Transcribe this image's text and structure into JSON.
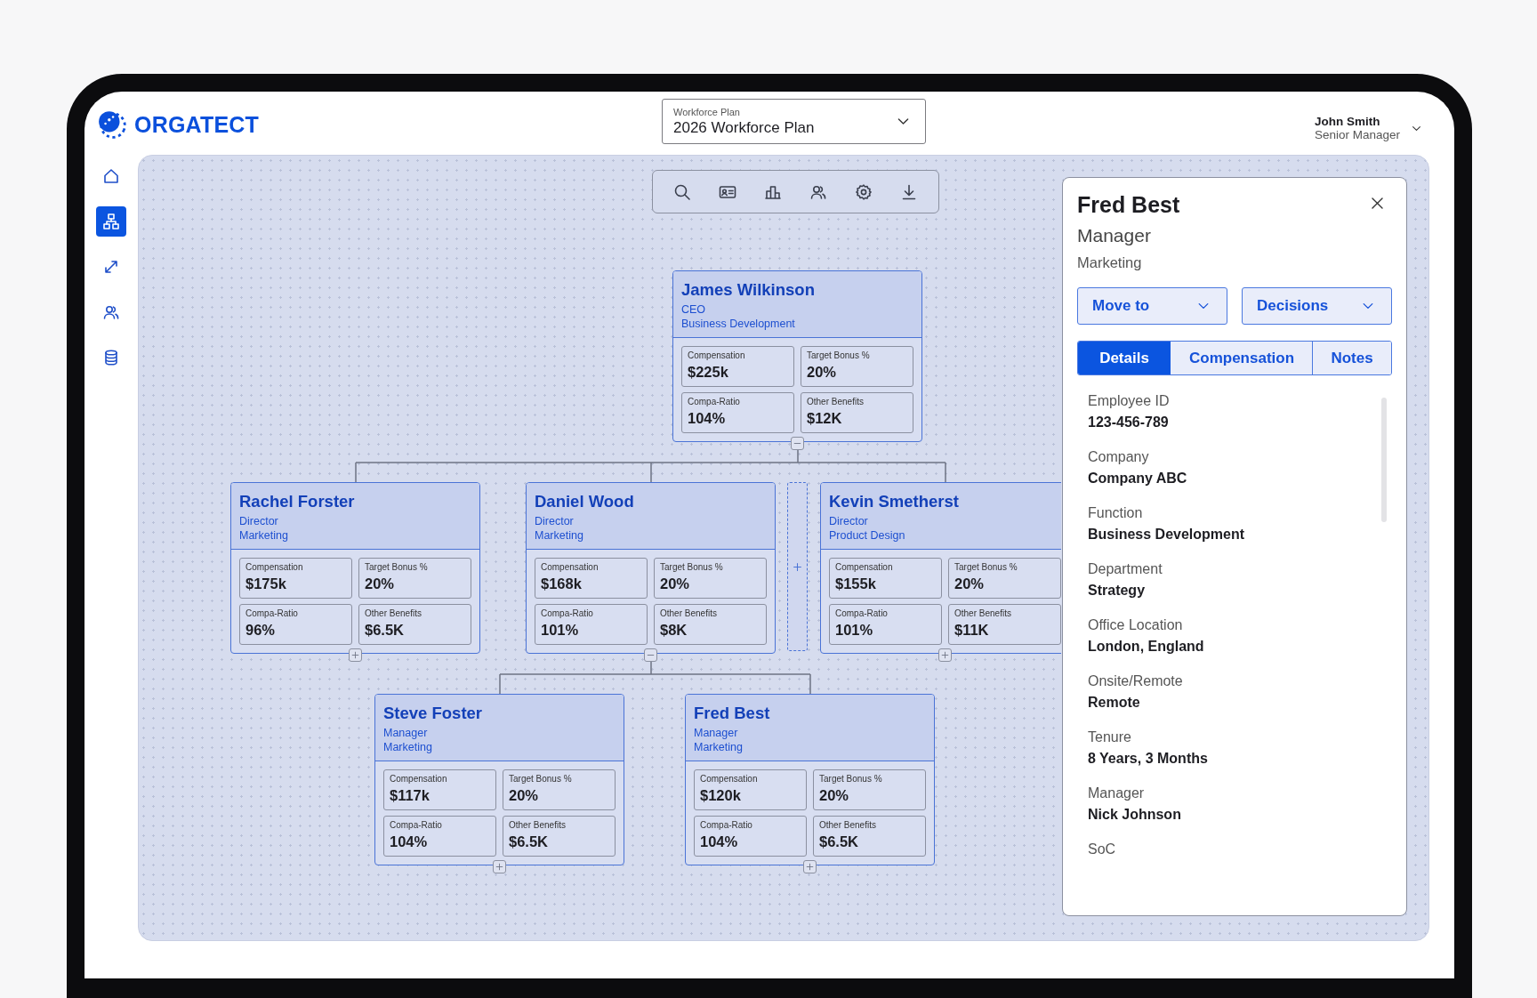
{
  "app": {
    "logo": "ORGATECT"
  },
  "plan_selector": {
    "label": "Workforce Plan",
    "value": "2026 Workforce Plan"
  },
  "user": {
    "name": "John Smith",
    "role": "Senior Manager"
  },
  "sidebar": {
    "items": [
      {
        "kind": "home",
        "selected": false
      },
      {
        "kind": "org",
        "selected": true
      },
      {
        "kind": "transfer",
        "selected": false
      },
      {
        "kind": "people",
        "selected": false
      },
      {
        "kind": "database",
        "selected": false
      }
    ]
  },
  "toolbar": {
    "tools": [
      {
        "kind": "search"
      },
      {
        "kind": "id-card"
      },
      {
        "kind": "chart"
      },
      {
        "kind": "people"
      },
      {
        "kind": "settings"
      },
      {
        "kind": "download"
      }
    ]
  },
  "org_chart": {
    "root": {
      "kind": "person",
      "name": "James Wilkinson",
      "title": "CEO",
      "department": "Business Development",
      "expanded": true,
      "metrics": [
        {
          "label": "Compensation",
          "value": "$225k"
        },
        {
          "label": "Target Bonus %",
          "value": "20%"
        },
        {
          "label": "Compa-Ratio",
          "value": "104%"
        },
        {
          "label": "Other Benefits",
          "value": "$12K"
        }
      ],
      "children": [
        {
          "kind": "person",
          "name": "Rachel Forster",
          "title": "Director",
          "department": "Marketing",
          "expanded": false,
          "metrics": [
            {
              "label": "Compensation",
              "value": "$175k"
            },
            {
              "label": "Target Bonus %",
              "value": "20%"
            },
            {
              "label": "Compa-Ratio",
              "value": "96%"
            },
            {
              "label": "Other Benefits",
              "value": "$6.5K"
            }
          ]
        },
        {
          "kind": "person",
          "name": "Daniel Wood",
          "title": "Director",
          "department": "Marketing",
          "expanded": true,
          "metrics": [
            {
              "label": "Compensation",
              "value": "$168k"
            },
            {
              "label": "Target Bonus %",
              "value": "20%"
            },
            {
              "label": "Compa-Ratio",
              "value": "101%"
            },
            {
              "label": "Other Benefits",
              "value": "$8K"
            }
          ],
          "children": [
            {
              "kind": "person",
              "name": "Steve Foster",
              "title": "Manager",
              "department": "Marketing",
              "expanded": false,
              "metrics": [
                {
                  "label": "Compensation",
                  "value": "$117k"
                },
                {
                  "label": "Target Bonus %",
                  "value": "20%"
                },
                {
                  "label": "Compa-Ratio",
                  "value": "104%"
                },
                {
                  "label": "Other Benefits",
                  "value": "$6.5K"
                }
              ]
            },
            {
              "kind": "person",
              "name": "Fred Best",
              "title": "Manager",
              "department": "Marketing",
              "expanded": false,
              "metrics": [
                {
                  "label": "Compensation",
                  "value": "$120k"
                },
                {
                  "label": "Target Bonus %",
                  "value": "20%"
                },
                {
                  "label": "Compa-Ratio",
                  "value": "104%"
                },
                {
                  "label": "Other Benefits",
                  "value": "$6.5K"
                }
              ]
            }
          ]
        },
        {
          "kind": "placeholder"
        },
        {
          "kind": "person",
          "name": "Kevin Smetherst",
          "title": "Director",
          "department": "Product Design",
          "expanded": false,
          "metrics": [
            {
              "label": "Compensation",
              "value": "$155k"
            },
            {
              "label": "Target Bonus %",
              "value": "20%"
            },
            {
              "label": "Compa-Ratio",
              "value": "101%"
            },
            {
              "label": "Other Benefits",
              "value": "$11K"
            }
          ]
        }
      ]
    }
  },
  "detail_panel": {
    "name": "Fred Best",
    "title": "Manager",
    "department": "Marketing",
    "actions": [
      "Move to",
      "Decisions"
    ],
    "tabs": [
      {
        "label": "Details",
        "selected": true
      },
      {
        "label": "Compensation",
        "selected": false
      },
      {
        "label": "Notes",
        "selected": false
      }
    ],
    "fields": [
      {
        "label": "Employee ID",
        "value": "123-456-789"
      },
      {
        "label": "Company",
        "value": "Company ABC"
      },
      {
        "label": "Function",
        "value": "Business Development"
      },
      {
        "label": "Department",
        "value": "Strategy"
      },
      {
        "label": "Office Location",
        "value": "London, England"
      },
      {
        "label": "Onsite/Remote",
        "value": "Remote"
      },
      {
        "label": "Tenure",
        "value": "8 Years, 3 Months"
      },
      {
        "label": "Manager",
        "value": "Nick Johnson"
      },
      {
        "label": "SoC"
      }
    ]
  }
}
